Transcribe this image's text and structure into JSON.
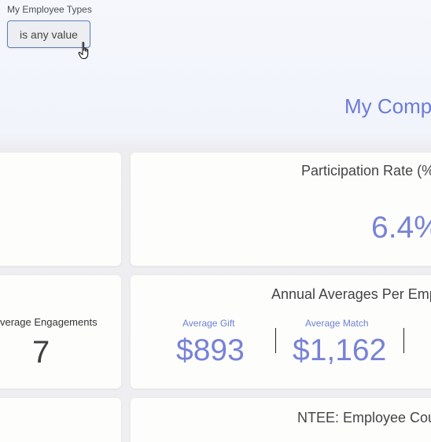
{
  "filter": {
    "label": "My Employee Types",
    "value": "is any value"
  },
  "page": {
    "title": "My Comp"
  },
  "cards": {
    "participation": {
      "title": "Participation Rate (%",
      "value": "6.4%"
    },
    "engagements": {
      "label": "verage Engagements",
      "value": "7"
    },
    "annual": {
      "title": "Annual Averages Per Emp",
      "gift_label": "Average Gift",
      "gift_value": "$893",
      "match_label": "Average Match",
      "match_value": "$1,162"
    },
    "ntee": {
      "title": "NTEE: Employee Cou"
    }
  },
  "colors": {
    "accent": "#7783d6",
    "title_accent": "#6b7bd6",
    "button_border": "#5b7fb8"
  }
}
